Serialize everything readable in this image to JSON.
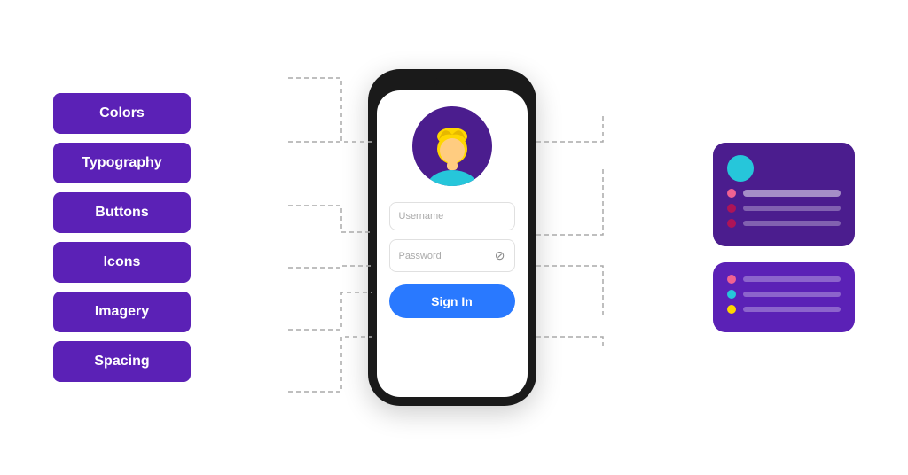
{
  "left": {
    "buttons": [
      {
        "id": "colors",
        "label": "Colors"
      },
      {
        "id": "typography",
        "label": "Typography"
      },
      {
        "id": "buttons",
        "label": "Buttons"
      },
      {
        "id": "icons",
        "label": "Icons"
      },
      {
        "id": "imagery",
        "label": "Imagery"
      },
      {
        "id": "spacing",
        "label": "Spacing"
      }
    ]
  },
  "phone": {
    "username_placeholder": "Username",
    "password_placeholder": "Password",
    "signin_label": "Sign In"
  },
  "right_card1": {
    "bars": [
      "header",
      "sub1",
      "sub2",
      "sub3"
    ]
  },
  "right_card2": {
    "rows": [
      "row1",
      "row2",
      "row3"
    ]
  }
}
